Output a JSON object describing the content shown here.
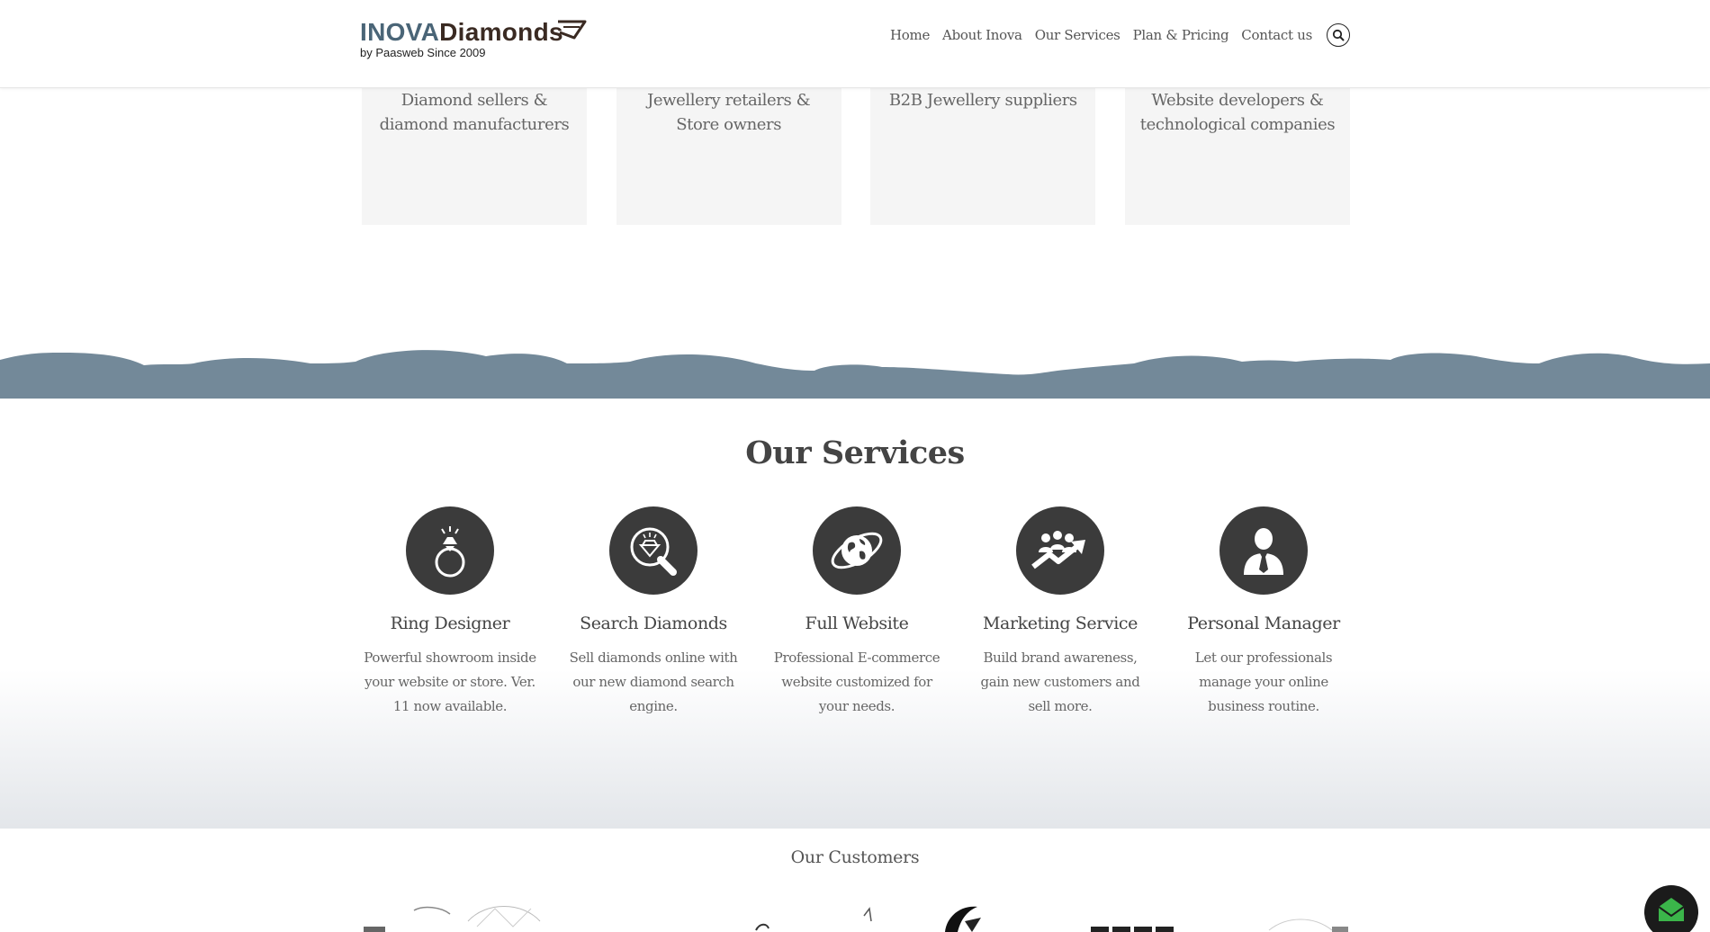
{
  "header": {
    "logo_part1": "INOVA",
    "logo_part2": "Diamonds",
    "logo_tagline": "by Paasweb Since 2009",
    "nav": [
      "Home",
      "About Inova",
      "Our Services",
      "Plan & Pricing",
      "Contact us"
    ],
    "search_icon": "search-icon"
  },
  "audience": {
    "cards": [
      "Diamond sellers & diamond manufacturers",
      "Jewellery retailers & Store owners",
      "B2B Jewellery suppliers",
      "Website developers & technological companies"
    ]
  },
  "services": {
    "title": "Our Services",
    "items": [
      {
        "name": "Ring Designer",
        "desc": "Powerful showroom inside your website or store. Ver. 11 now available.",
        "icon": "ring-icon"
      },
      {
        "name": "Search Diamonds",
        "desc": "Sell diamonds online with our new diamond search engine.",
        "icon": "diamond-search-icon"
      },
      {
        "name": "Full Website",
        "desc": "Professional E-commerce website customized for your needs.",
        "icon": "globe-icon"
      },
      {
        "name": "Marketing Service",
        "desc": "Build brand awareness, gain new customers and sell more.",
        "icon": "growth-chart-icon"
      },
      {
        "name": "Personal Manager",
        "desc": "Let our professionals manage your online business routine.",
        "icon": "manager-icon"
      }
    ]
  },
  "customers": {
    "title": "Our Customers"
  },
  "colors": {
    "wave": "#738999",
    "icon_bg": "#3b3b3b",
    "logo_blue": "#4a6577",
    "logo_brown": "#3a2a22",
    "chat_green": "#3bb54a"
  }
}
